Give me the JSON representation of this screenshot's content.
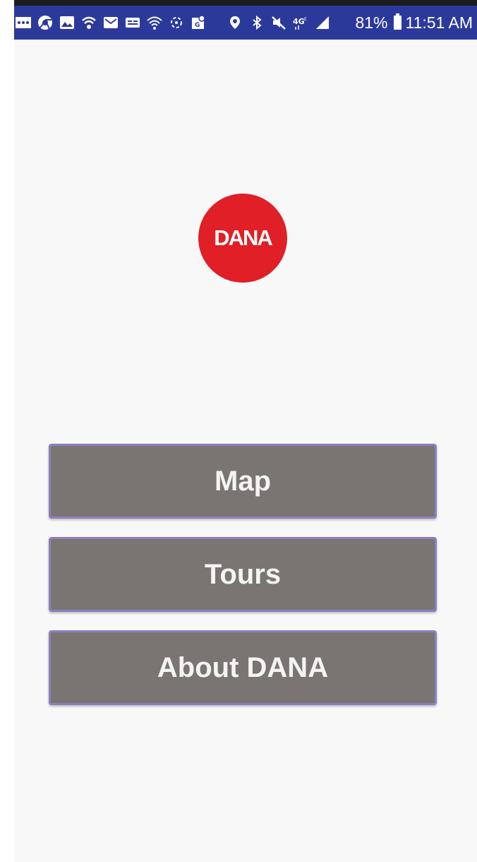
{
  "status_bar": {
    "battery_text": "81%",
    "time": "11:51 AM",
    "icons": [
      "more-icon",
      "chrome-icon",
      "gallery-icon",
      "wifi-call-icon",
      "mail-icon",
      "chat-icon",
      "wifi-icon",
      "sync-icon",
      "maps-icon",
      "location-icon",
      "bluetooth-icon",
      "mute-icon",
      "lte-icon",
      "signal-icon",
      "battery-icon"
    ]
  },
  "logo": {
    "text": "DANA",
    "color": "#e01f26"
  },
  "menu": {
    "map_label": "Map",
    "tours_label": "Tours",
    "about_label": "About DANA"
  },
  "colors": {
    "status_bar": "#2b3a9a",
    "button_fill": "#7a7572",
    "button_border": "#8b80c0",
    "background": "#f8f8f8"
  }
}
